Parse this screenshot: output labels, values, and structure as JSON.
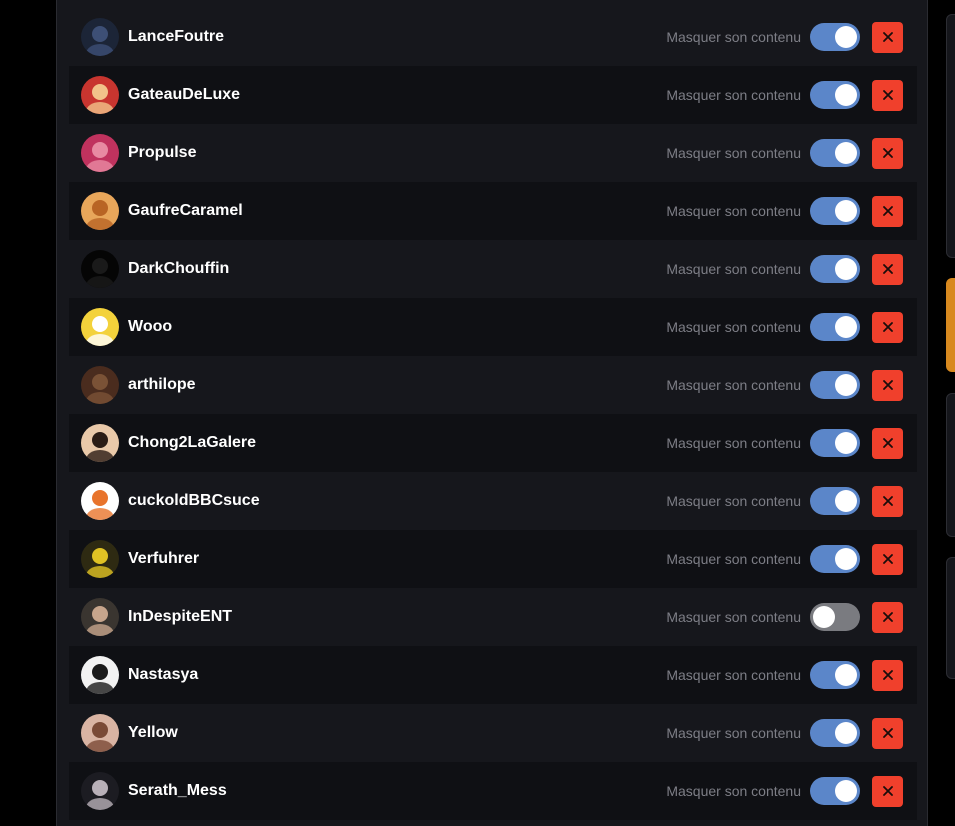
{
  "colors": {
    "accent_toggle": "#5b86c9",
    "toggle_off": "#7a7b80",
    "remove_button": "#f0402c",
    "panel_bg": "#16171c",
    "row_alt_bg": "#0f1014"
  },
  "users": [
    {
      "username": "LanceFoutre",
      "hide_label": "Masquer son contenu",
      "hide_on": true,
      "avatar_colors": [
        "#1c2537",
        "#3d4f75"
      ]
    },
    {
      "username": "GateauDeLuxe",
      "hide_label": "Masquer son contenu",
      "hide_on": true,
      "avatar_colors": [
        "#c8352f",
        "#f2c38a"
      ]
    },
    {
      "username": "Propulse",
      "hide_label": "Masquer son contenu",
      "hide_on": true,
      "avatar_colors": [
        "#c0325e",
        "#e88aa2"
      ]
    },
    {
      "username": "GaufreCaramel",
      "hide_label": "Masquer son contenu",
      "hide_on": true,
      "avatar_colors": [
        "#e8a65a",
        "#b86424"
      ]
    },
    {
      "username": "DarkChouffin",
      "hide_label": "Masquer son contenu",
      "hide_on": true,
      "avatar_colors": [
        "#050505",
        "#1a1a1a"
      ]
    },
    {
      "username": "Wooo",
      "hide_label": "Masquer son contenu",
      "hide_on": true,
      "avatar_colors": [
        "#f3d23b",
        "#ffffff"
      ]
    },
    {
      "username": "arthilope",
      "hide_label": "Masquer son contenu",
      "hide_on": true,
      "avatar_colors": [
        "#4a2c1e",
        "#7a5236"
      ]
    },
    {
      "username": "Chong2LaGalere",
      "hide_label": "Masquer son contenu",
      "hide_on": true,
      "avatar_colors": [
        "#e9c9a9",
        "#2a1c14"
      ]
    },
    {
      "username": "cuckoldBBCsuce",
      "hide_label": "Masquer son contenu",
      "hide_on": true,
      "avatar_colors": [
        "#ffffff",
        "#e8742c"
      ]
    },
    {
      "username": "Verfuhrer",
      "hide_label": "Masquer son contenu",
      "hide_on": true,
      "avatar_colors": [
        "#2e2a12",
        "#e0c224"
      ]
    },
    {
      "username": "InDespiteENT",
      "hide_label": "Masquer son contenu",
      "hide_on": false,
      "avatar_colors": [
        "#3a3530",
        "#c7a58c"
      ]
    },
    {
      "username": "Nastasya",
      "hide_label": "Masquer son contenu",
      "hide_on": true,
      "avatar_colors": [
        "#f2f2f2",
        "#1a1a1a"
      ]
    },
    {
      "username": "Yellow",
      "hide_label": "Masquer son contenu",
      "hide_on": true,
      "avatar_colors": [
        "#d9b4a3",
        "#7a4a36"
      ]
    },
    {
      "username": "Serath_Mess",
      "hide_label": "Masquer son contenu",
      "hide_on": true,
      "avatar_colors": [
        "#1c1c22",
        "#b8b0b8"
      ]
    }
  ]
}
